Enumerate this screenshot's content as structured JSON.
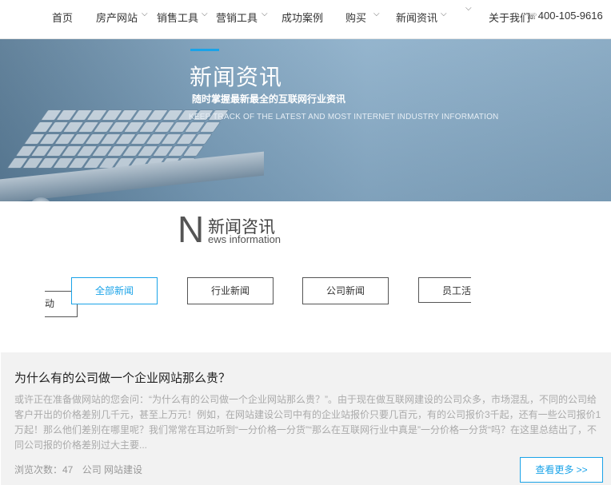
{
  "nav": {
    "items": [
      {
        "label": "首页"
      },
      {
        "label": "房产网站"
      },
      {
        "label": "销售工具"
      },
      {
        "label": "营销工具"
      },
      {
        "label": "成功案例"
      },
      {
        "label": "购买"
      },
      {
        "label": "新闻资讯"
      },
      {
        "label": "关于我们"
      }
    ],
    "phone": "400-105-9616",
    "phone_icon": "phone-icon"
  },
  "banner": {
    "title": "新闻资讯",
    "subtitle": "随时掌握最新最全的互联网行业资讯",
    "english": "KEEP TRACK OF THE LATEST AND MOST INTERNET INDUSTRY INFORMATION",
    "accent_color": "#1aa3e8"
  },
  "section": {
    "initial": "N",
    "title": "新闻咨讯",
    "english": "ews information"
  },
  "tabs": {
    "fragment_left": "动",
    "items": [
      {
        "label": "全部新闻",
        "active": true
      },
      {
        "label": "行业新闻",
        "active": false
      },
      {
        "label": "公司新闻",
        "active": false
      }
    ],
    "fragment_right": "员工活"
  },
  "article": {
    "title": "为什么有的公司做一个企业网站那么贵？",
    "body": "或许正在准备做网站的您会问：“为什么有的公司做一个企业网站那么贵？”。由于现在做互联网建设的公司众多，市场混乱，不同的公司给客户开出的价格差别几千元，甚至上万元！例如，在网站建设公司中有的企业站报价只要几百元，有的公司报价3千起，还有一些公司报价1万起！那么他们差别在哪里呢？我们常常在耳边听到“一分价格一分货”“那么在互联网行业中真是”一分价格一分货“吗？在这里总结出了，不同公司报的价格差别过大主要...",
    "views_label": "浏览次数：47",
    "tags": "公司 网站建设",
    "more_label": "查看更多 >>"
  }
}
